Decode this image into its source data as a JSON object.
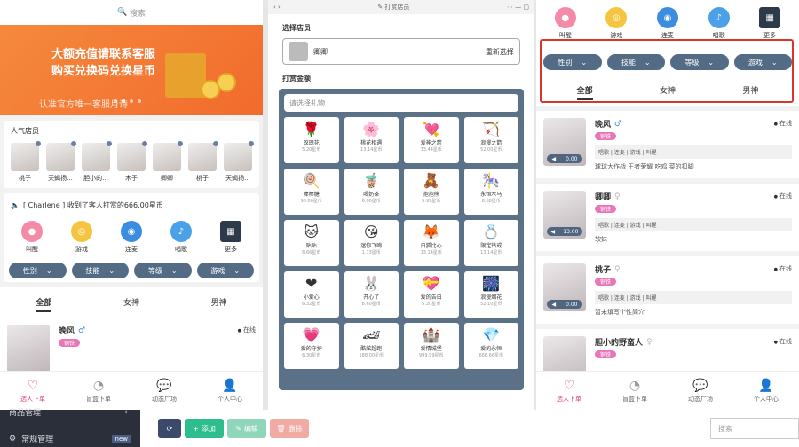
{
  "search": {
    "placeholder": "搜索"
  },
  "banner": {
    "line1": "大额充值请联系客服",
    "line2": "购买兑换码兑换星币",
    "line3": "认准官方唯一客服月诗"
  },
  "popular": {
    "title": "人气店员",
    "items": [
      {
        "name": "桃子"
      },
      {
        "name": "天蝎扬..."
      },
      {
        "name": "胆小的..."
      },
      {
        "name": "木子"
      },
      {
        "name": "卿卿"
      },
      {
        "name": "桃子"
      },
      {
        "name": "天蝎扬..."
      }
    ]
  },
  "notice": {
    "text": "[ Charlene ] 收到了客人打赏的666.00星币"
  },
  "categories": [
    {
      "label": "叫醒",
      "icon": "pig-icon",
      "color": "#f48aa8"
    },
    {
      "label": "游戏",
      "icon": "game-icon",
      "color": "#f5c542"
    },
    {
      "label": "连麦",
      "icon": "mic-icon",
      "color": "#3b8de0"
    },
    {
      "label": "唱歌",
      "icon": "music-icon",
      "color": "#4aa1e8"
    },
    {
      "label": "更多",
      "icon": "grid-icon",
      "color": "#2d3a4a"
    }
  ],
  "filters": [
    "性别",
    "技能",
    "等级",
    "游戏"
  ],
  "tabs": [
    "全部",
    "女神",
    "男神"
  ],
  "hosts": [
    {
      "name": "晚风",
      "gender": "♂",
      "badge": "铜铁",
      "online": "在线",
      "skills": "唱歌 | 连麦 | 游戏 | 叫醒",
      "intro": "球球大作战 王者荣耀 吃鸡 菜的扣脚",
      "dur": "0.00"
    },
    {
      "name": "卿卿",
      "gender": "♀",
      "badge": "铜铁",
      "online": "在线",
      "skills": "唱歌 | 连麦 | 游戏 | 叫醒",
      "intro": "软妹",
      "dur": "13.00"
    },
    {
      "name": "桃子",
      "gender": "♀",
      "badge": "铜铁",
      "online": "在线",
      "skills": "唱歌 | 连麦 | 游戏 | 叫醒",
      "intro": "暂未填写个性简介",
      "dur": "0.00"
    },
    {
      "name": "胆小的野蛮人",
      "gender": "♀",
      "badge": "铜铁",
      "online": "在线",
      "skills": "",
      "intro": "",
      "dur": ""
    }
  ],
  "bottom_nav": [
    {
      "label": "选人下单",
      "icon": "heart-icon"
    },
    {
      "label": "盲盒下单",
      "icon": "clock-icon"
    },
    {
      "label": "动态广场",
      "icon": "chat-icon"
    },
    {
      "label": "个人中心",
      "icon": "user-icon"
    }
  ],
  "reward": {
    "window_title": "打赏店员",
    "store_title": "选择店员",
    "store_name": "卿卿",
    "reselect": "重新选择",
    "amount_title": "打赏金额",
    "gift_placeholder": "请选择礼物",
    "gifts": [
      {
        "name": "玫瑰花",
        "price": "5.20星币",
        "icon": "🌹"
      },
      {
        "name": "桃花相遇",
        "price": "13.14星币",
        "icon": "🌸"
      },
      {
        "name": "爱神之箭",
        "price": "33.44星币",
        "icon": "💘"
      },
      {
        "name": "浪漫之箭",
        "price": "52.00星币",
        "icon": "🏹"
      },
      {
        "name": "棒棒糖",
        "price": "99.00星币",
        "icon": "🍭"
      },
      {
        "name": "喝奶茶",
        "price": "6.00星币",
        "icon": "🧋"
      },
      {
        "name": "抱抱熊",
        "price": "9.99星币",
        "icon": "🧸"
      },
      {
        "name": "永恒木马",
        "price": "8.88星币",
        "icon": "🎠"
      },
      {
        "name": "贴贴",
        "price": "6.66星币",
        "icon": "🐱"
      },
      {
        "name": "迷你飞吻",
        "price": "1.13星币",
        "icon": "😘"
      },
      {
        "name": "白狐比心",
        "price": "13.14星币",
        "icon": "🦊"
      },
      {
        "name": "限定钻戒",
        "price": "13.14星币",
        "icon": "💍"
      },
      {
        "name": "小爱心",
        "price": "6.32星币",
        "icon": "❤"
      },
      {
        "name": "开心了",
        "price": "8.60星币",
        "icon": "🐰"
      },
      {
        "name": "爱的告白",
        "price": "5.20星币",
        "icon": "💝"
      },
      {
        "name": "浪漫烟花",
        "price": "52.10星币",
        "icon": "🎆"
      },
      {
        "name": "爱的守护",
        "price": "6.30星币",
        "icon": "💗"
      },
      {
        "name": "酷炫超跑",
        "price": "188.00星币",
        "icon": "🏎"
      },
      {
        "name": "爱情城堡",
        "price": "999.99星币",
        "icon": "🏰"
      },
      {
        "name": "爱的永恒",
        "price": "666.66星币",
        "icon": "💎"
      }
    ]
  },
  "admin": {
    "menu1": "商品管理",
    "menu2": "常规管理",
    "new_badge": "new",
    "add": "添加",
    "edit": "编辑",
    "delete": "删除",
    "search_placeholder": "搜索"
  }
}
